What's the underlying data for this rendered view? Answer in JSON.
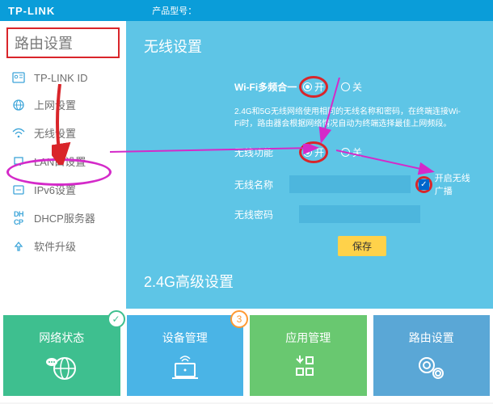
{
  "logo": "TP-LINK",
  "product_label": "产品型号：",
  "sidebar": {
    "title": "路由设置",
    "items": [
      {
        "label": "TP-LINK ID"
      },
      {
        "label": "上网设置"
      },
      {
        "label": "无线设置"
      },
      {
        "label": "LAN口设置"
      },
      {
        "label": "IPv6设置"
      },
      {
        "label": "DHCP服务器"
      },
      {
        "label": "软件升级"
      }
    ]
  },
  "content": {
    "title": "无线设置",
    "multiband_label": "Wi-Fi多频合一",
    "on": "开",
    "off": "关",
    "desc": "2.4G和5G无线网络使用相同的无线名称和密码，在终端连接Wi-Fi时，路由器会根据网络情况自动为终端选择最佳上网频段。",
    "wireless_label": "无线功能",
    "ssid_label": "无线名称",
    "broadcast_label": "开启无线广播",
    "pwd_label": "无线密码",
    "save": "保存",
    "adv_title": "2.4G高级设置"
  },
  "tiles": [
    {
      "label": "网络状态",
      "badge": "✓"
    },
    {
      "label": "设备管理",
      "badge": "3"
    },
    {
      "label": "应用管理",
      "badge": ""
    },
    {
      "label": "路由设置",
      "badge": ""
    }
  ]
}
